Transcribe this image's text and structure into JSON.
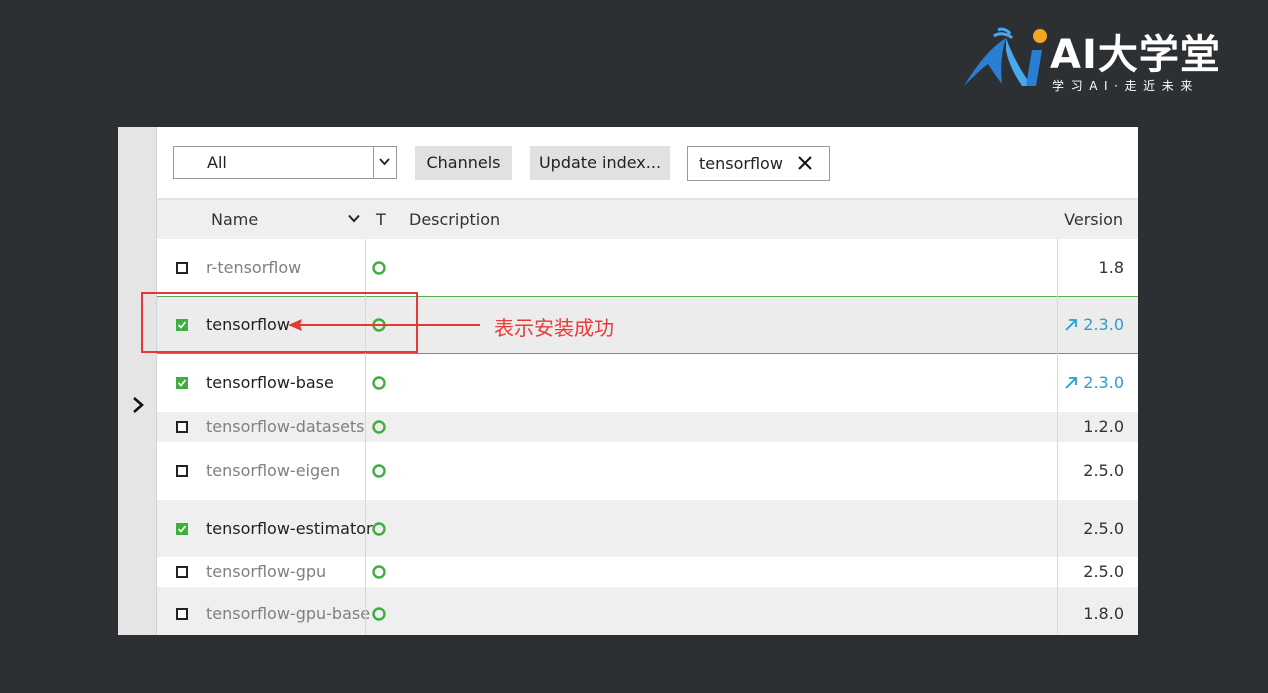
{
  "logo": {
    "title": "AI大学堂",
    "subtitle": "学习AI·走近未来"
  },
  "toolbar": {
    "filter_value": "All",
    "channels_label": "Channels",
    "update_index_label": "Update index...",
    "search_value": "tensorflow"
  },
  "table": {
    "headers": {
      "name": "Name",
      "type": "T",
      "description": "Description",
      "version": "Version"
    },
    "rows": [
      {
        "name": "r-tensorflow",
        "checked": false,
        "version": "1.8",
        "upgradable": false
      },
      {
        "name": "tensorflow",
        "checked": true,
        "version": "2.3.0",
        "upgradable": true
      },
      {
        "name": "tensorflow-base",
        "checked": true,
        "version": "2.3.0",
        "upgradable": true
      },
      {
        "name": "tensorflow-datasets",
        "checked": false,
        "version": "1.2.0",
        "upgradable": false
      },
      {
        "name": "tensorflow-eigen",
        "checked": false,
        "version": "2.5.0",
        "upgradable": false
      },
      {
        "name": "tensorflow-estimator",
        "checked": true,
        "version": "2.5.0",
        "upgradable": false
      },
      {
        "name": "tensorflow-gpu",
        "checked": false,
        "version": "2.5.0",
        "upgradable": false
      },
      {
        "name": "tensorflow-gpu-base",
        "checked": false,
        "version": "1.8.0",
        "upgradable": false
      }
    ]
  },
  "annotation": {
    "text": "表示安装成功"
  },
  "colors": {
    "installed_check": "#3fae3f",
    "upgrade_version": "#2a9fd0",
    "status_ring": "#3fae3f",
    "annotation": "#e53935",
    "background": "#2d3033"
  },
  "icons": {
    "expand": "chevron-right-icon",
    "filter_dropdown": "chevron-down-icon",
    "clear_search": "close-icon",
    "status": "status-ring-icon",
    "upgrade": "arrow-up-right-icon"
  }
}
